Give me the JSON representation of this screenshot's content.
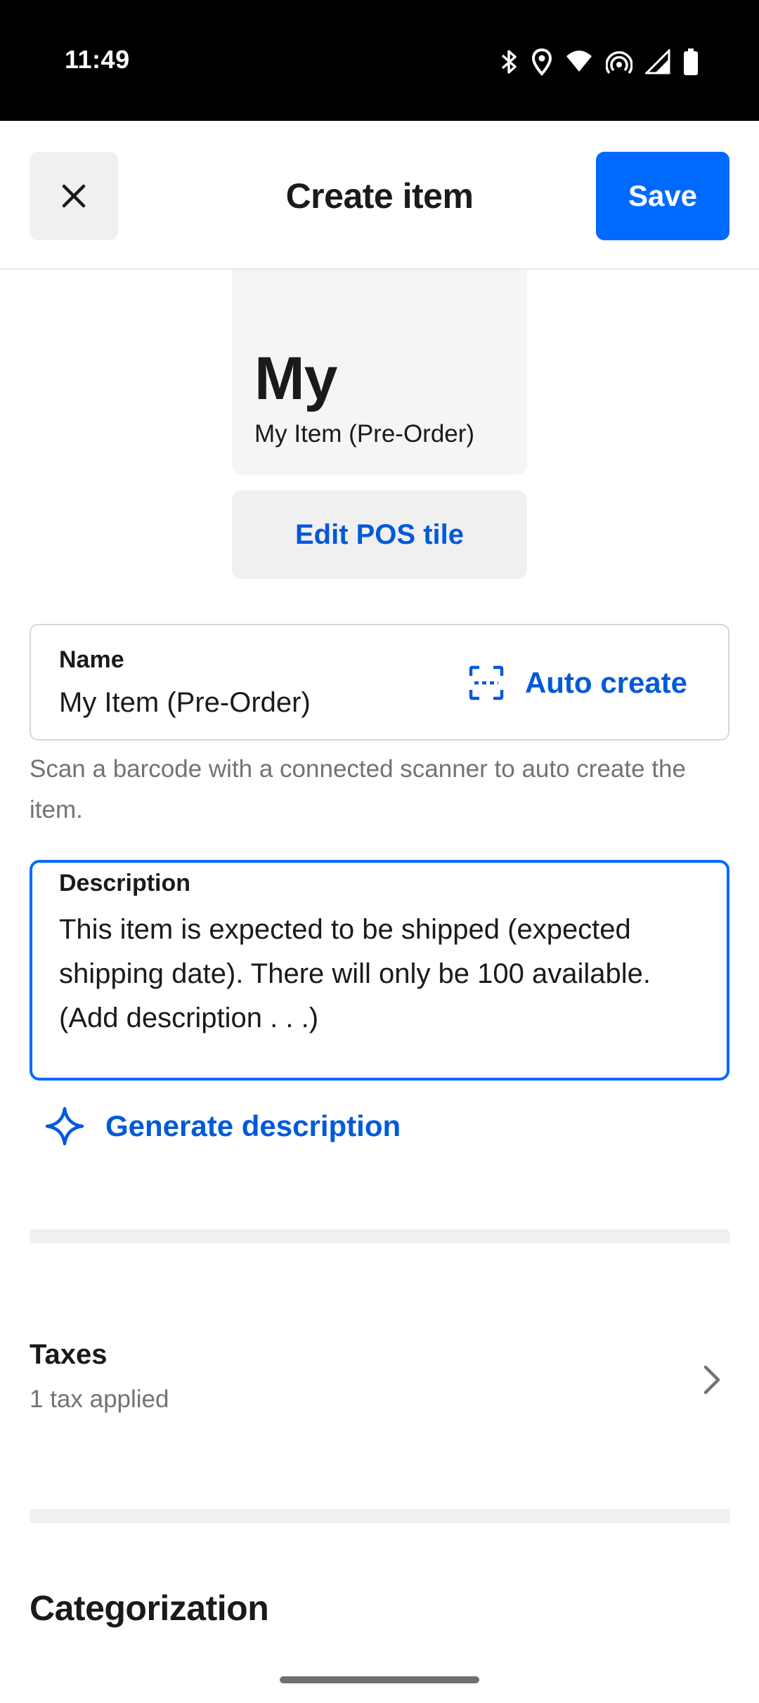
{
  "status_bar": {
    "time": "11:49",
    "icons": [
      "bluetooth-icon",
      "location-icon",
      "wifi-icon",
      "hotspot-icon",
      "cell-signal-icon",
      "battery-icon"
    ]
  },
  "header": {
    "close_icon": "close-icon",
    "title": "Create item",
    "save_label": "Save"
  },
  "pos_tile": {
    "abbreviation": "My",
    "name": "My Item (Pre-Order)",
    "edit_label": "Edit POS tile"
  },
  "name_field": {
    "label": "Name",
    "value": "My Item (Pre-Order)",
    "auto_create_label": "Auto create",
    "auto_create_icon": "barcode-scan-icon",
    "helper": "Scan a barcode with a connected scanner to auto create the item."
  },
  "description_field": {
    "label": "Description",
    "value": "This item is expected to be shipped (expected shipping date). There will only be 100 available. (Add description . . .)",
    "generate_label": "Generate description",
    "generate_icon": "sparkle-icon"
  },
  "taxes": {
    "title": "Taxes",
    "subtitle": "1 tax applied"
  },
  "categorization": {
    "title": "Categorization"
  },
  "colors": {
    "accent": "#006aff",
    "link": "#005ad9",
    "status_bar": "#000000"
  }
}
